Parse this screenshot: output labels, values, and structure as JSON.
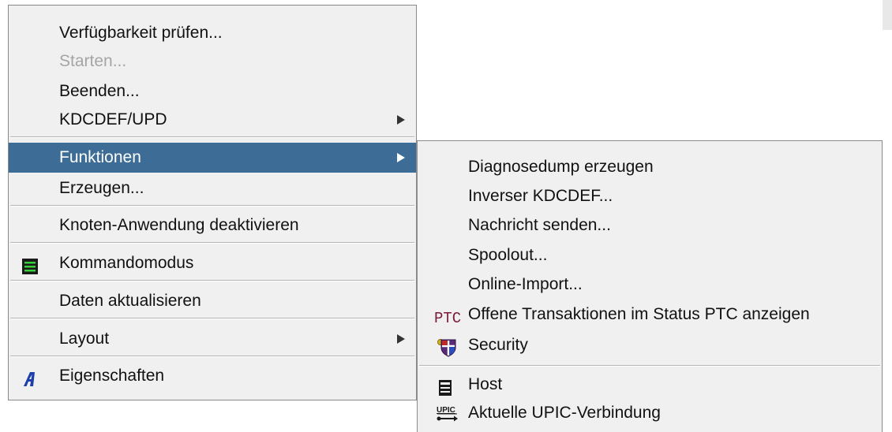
{
  "main_menu": {
    "items": [
      {
        "label": "Verfügbarkeit prüfen..."
      },
      {
        "label": "Starten..."
      },
      {
        "label": "Beenden..."
      },
      {
        "label": "KDCDEF/UPD"
      },
      {
        "label": "Funktionen"
      },
      {
        "label": "Erzeugen..."
      },
      {
        "label": "Knoten-Anwendung deaktivieren"
      },
      {
        "label": "Kommandomodus",
        "icon": "terminal-icon"
      },
      {
        "label": "Daten aktualisieren"
      },
      {
        "label": "Layout"
      },
      {
        "label": "Eigenschaften",
        "icon": "properties-icon"
      }
    ]
  },
  "sub_menu": {
    "items": [
      {
        "label": "Diagnosedump erzeugen"
      },
      {
        "label": "Inverser KDCDEF..."
      },
      {
        "label": "Nachricht senden..."
      },
      {
        "label": "Spoolout..."
      },
      {
        "label": "Online-Import..."
      },
      {
        "label": "Offene Transaktionen im Status PTC anzeigen",
        "icon_text": "PTC"
      },
      {
        "label": "Security",
        "icon": "security-shield-icon"
      },
      {
        "label": "Host",
        "icon": "host-icon"
      },
      {
        "label": "Aktuelle UPIC-Verbindung",
        "icon_text": "UPIC"
      }
    ]
  },
  "colors": {
    "highlight": "#3d6d96",
    "menu_bg": "#f0f0f0",
    "disabled_text": "#a5a5a5"
  }
}
